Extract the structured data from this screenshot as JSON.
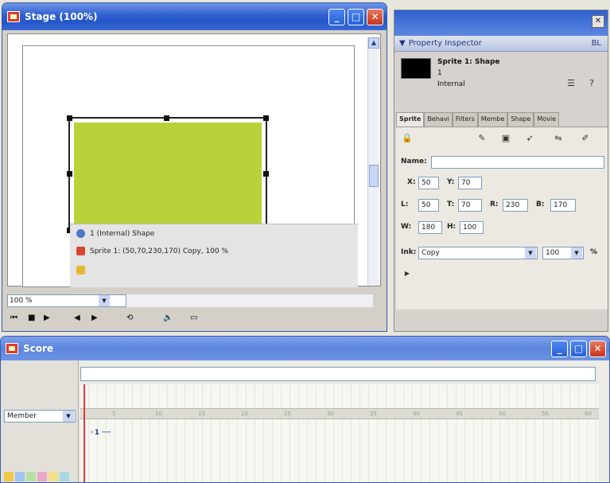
{
  "stage": {
    "title": "Stage (100%)",
    "zoom": "100 %",
    "tooltip": {
      "line1": "1 (Internal) Shape",
      "line2": "Sprite 1: (50,70,230,170) Copy, 100 %"
    }
  },
  "property_inspector": {
    "title": "Property Inspector",
    "header_right": "BL",
    "sprite_name": "Sprite 1: Shape",
    "sprite_number": "1",
    "cast": "Internal",
    "tabs": [
      "Sprite",
      "Behavi",
      "Filters",
      "Membe",
      "Shape",
      "Movie"
    ],
    "active_tab": "Sprite",
    "fields": {
      "name_label": "Name:",
      "name_value": "",
      "x_label": "X:",
      "x": "50",
      "y_label": "Y:",
      "y": "70",
      "l_label": "L:",
      "l": "50",
      "t_label": "T:",
      "t": "70",
      "r_label": "R:",
      "r": "230",
      "b_label": "B:",
      "b": "170",
      "w_label": "W:",
      "w": "180",
      "h_label": "H:",
      "h": "100",
      "ink_label": "Ink:",
      "ink": "Copy",
      "blend": "100",
      "percent": "%"
    }
  },
  "score": {
    "title": "Score",
    "member_select": "Member",
    "sprite_span": "◦1 ──",
    "ticks": [
      "5",
      "10",
      "15",
      "20",
      "25",
      "30",
      "35",
      "40",
      "45",
      "50",
      "55",
      "60"
    ]
  }
}
